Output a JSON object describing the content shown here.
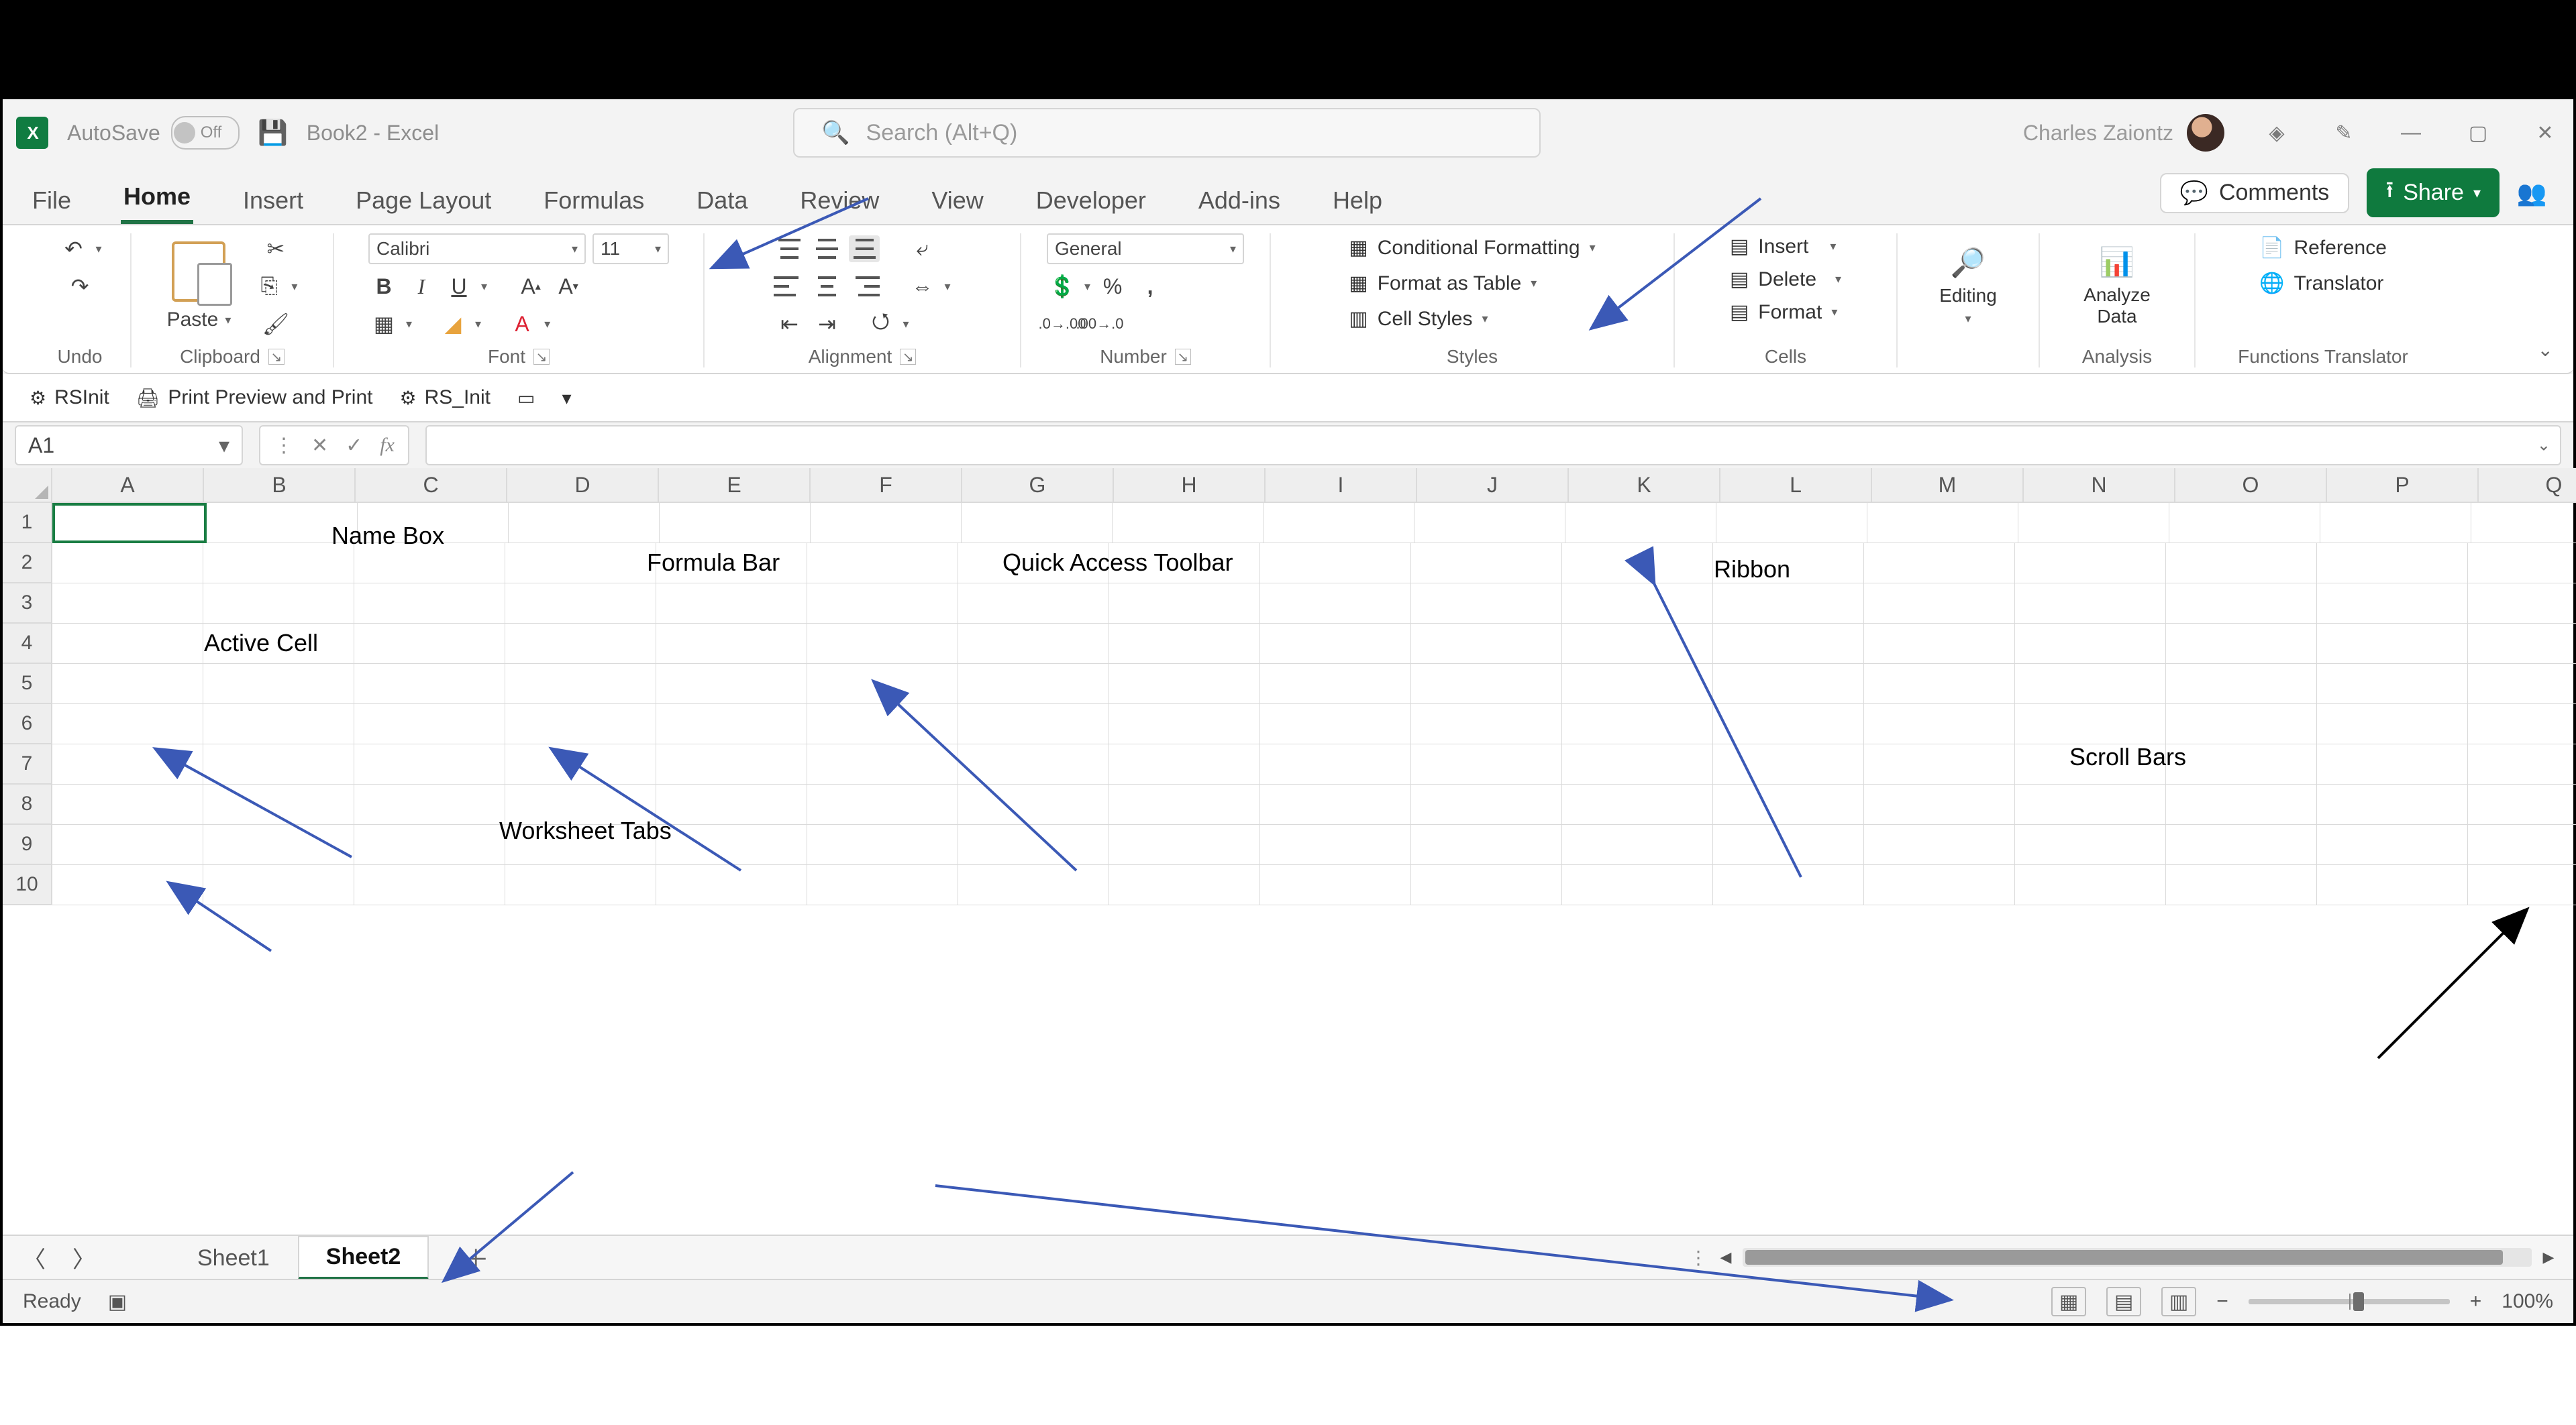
{
  "titlebar": {
    "autosave_label": "AutoSave",
    "autosave_state": "Off",
    "doc_title": "Book2  -  Excel",
    "search_placeholder": "Search (Alt+Q)",
    "user_name": "Charles Zaiontz"
  },
  "ribbon_tabs": {
    "items": [
      "File",
      "Home",
      "Insert",
      "Page Layout",
      "Formulas",
      "Data",
      "Review",
      "View",
      "Developer",
      "Add-ins",
      "Help"
    ],
    "active_index": 1,
    "comments_label": "Comments",
    "share_label": "Share"
  },
  "ribbon": {
    "undo_label": "Undo",
    "clipboard": {
      "label": "Clipboard",
      "paste_label": "Paste"
    },
    "font": {
      "label": "Font",
      "font_name": "Calibri",
      "font_size": "11"
    },
    "alignment": {
      "label": "Alignment"
    },
    "number": {
      "label": "Number",
      "format": "General"
    },
    "styles": {
      "label": "Styles",
      "cond_fmt": "Conditional Formatting",
      "fmt_table": "Format as Table",
      "cell_styles": "Cell Styles"
    },
    "cells": {
      "label": "Cells",
      "insert": "Insert",
      "delete": "Delete",
      "format": "Format"
    },
    "editing": {
      "label": "Editing"
    },
    "analysis": {
      "label": "Analysis",
      "analyze_data": "Analyze\nData"
    },
    "fntrans": {
      "label": "Functions Translator",
      "reference": "Reference",
      "translator": "Translator"
    }
  },
  "qat": {
    "rsinit": "RSInit",
    "print_preview": "Print Preview and Print",
    "rs_init": "RS_Init"
  },
  "fxbar": {
    "name_box": "A1"
  },
  "grid": {
    "columns": [
      "A",
      "B",
      "C",
      "D",
      "E",
      "F",
      "G",
      "H",
      "I",
      "J",
      "K",
      "L",
      "M",
      "N",
      "O",
      "P",
      "Q"
    ],
    "rows": [
      "1",
      "2",
      "3",
      "4",
      "5",
      "6",
      "7",
      "8",
      "9",
      "10"
    ]
  },
  "annotations": {
    "name_box": "Name Box",
    "active_cell": "Active Cell",
    "formula_bar": "Formula Bar",
    "qat": "Quick Access Toolbar",
    "ribbon": "Ribbon",
    "worksheet_tabs": "Worksheet Tabs",
    "scroll_bars": "Scroll Bars"
  },
  "sheets": {
    "tabs": [
      "Sheet1",
      "Sheet2"
    ],
    "active_index": 1
  },
  "status": {
    "ready": "Ready",
    "zoom": "100%"
  }
}
